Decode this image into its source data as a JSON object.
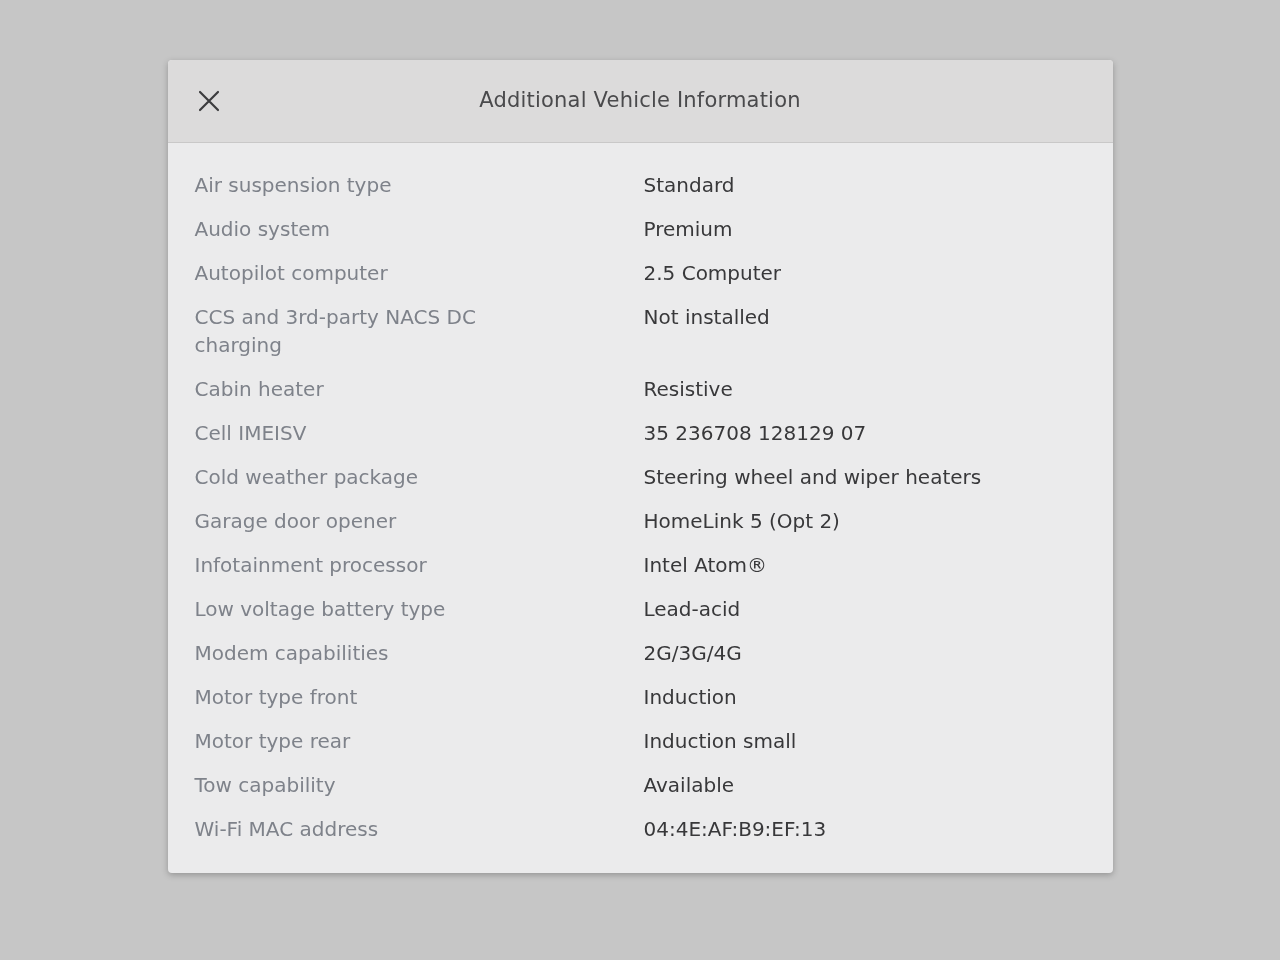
{
  "dialog": {
    "title": "Additional Vehicle Information",
    "rows": [
      {
        "label": "Air suspension type",
        "value": "Standard"
      },
      {
        "label": "Audio system",
        "value": "Premium"
      },
      {
        "label": "Autopilot computer",
        "value": "2.5 Computer"
      },
      {
        "label": "CCS and 3rd-party NACS DC charging",
        "value": "Not installed"
      },
      {
        "label": "Cabin heater",
        "value": "Resistive"
      },
      {
        "label": "Cell IMEISV",
        "value": "35 236708 128129 07"
      },
      {
        "label": "Cold weather package",
        "value": "Steering wheel and wiper heaters"
      },
      {
        "label": "Garage door opener",
        "value": "HomeLink 5 (Opt 2)"
      },
      {
        "label": "Infotainment processor",
        "value": "Intel Atom®"
      },
      {
        "label": "Low voltage battery type",
        "value": "Lead-acid"
      },
      {
        "label": "Modem capabilities",
        "value": "2G/3G/4G"
      },
      {
        "label": "Motor type front",
        "value": "Induction"
      },
      {
        "label": "Motor type rear",
        "value": "Induction small"
      },
      {
        "label": "Tow capability",
        "value": "Available"
      },
      {
        "label": "Wi-Fi MAC address",
        "value": "04:4E:AF:B9:EF:13"
      }
    ]
  }
}
